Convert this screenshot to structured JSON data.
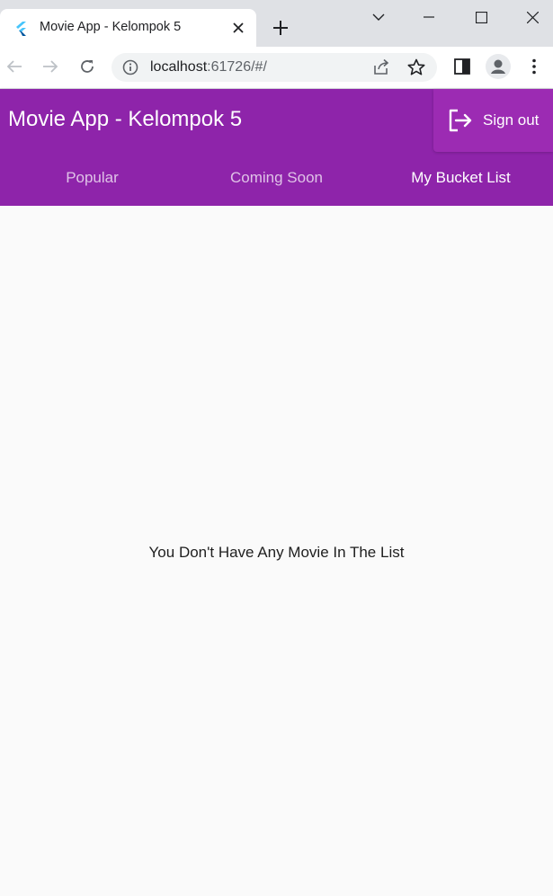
{
  "browser": {
    "tab_title": "Movie App - Kelompok 5",
    "url_host": "localhost",
    "url_path": ":61726/#/"
  },
  "app": {
    "title": "Movie App - Kelompok 5",
    "signout_label": "Sign out",
    "tabs": [
      {
        "label": "Popular",
        "active": false
      },
      {
        "label": "Coming Soon",
        "active": false
      },
      {
        "label": "My Bucket List",
        "active": true
      }
    ],
    "empty_message": "You Don't Have Any Movie In The List"
  },
  "colors": {
    "primary": "#8e24aa",
    "tabstrip": "#dfe1e5",
    "background": "#fafafa"
  }
}
